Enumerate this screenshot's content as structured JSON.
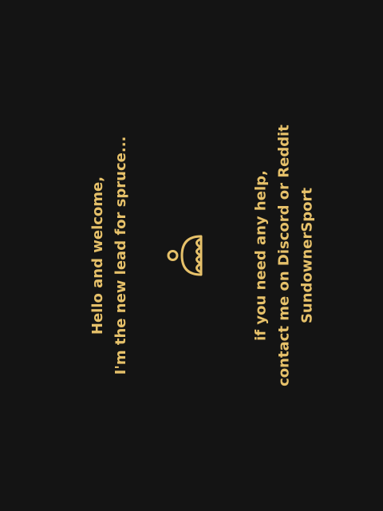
{
  "colors": {
    "background": "#141414",
    "accent": "#e6c16a"
  },
  "logo": {
    "icon": "spruce-logo-icon"
  },
  "welcome": {
    "line1": "Hello and welcome,",
    "line2": "I'm the new lead for spruce..."
  },
  "help": {
    "line1": "if you need any help,",
    "line2": "contact me on Discord or Reddit",
    "line3": "SundownerSport"
  }
}
